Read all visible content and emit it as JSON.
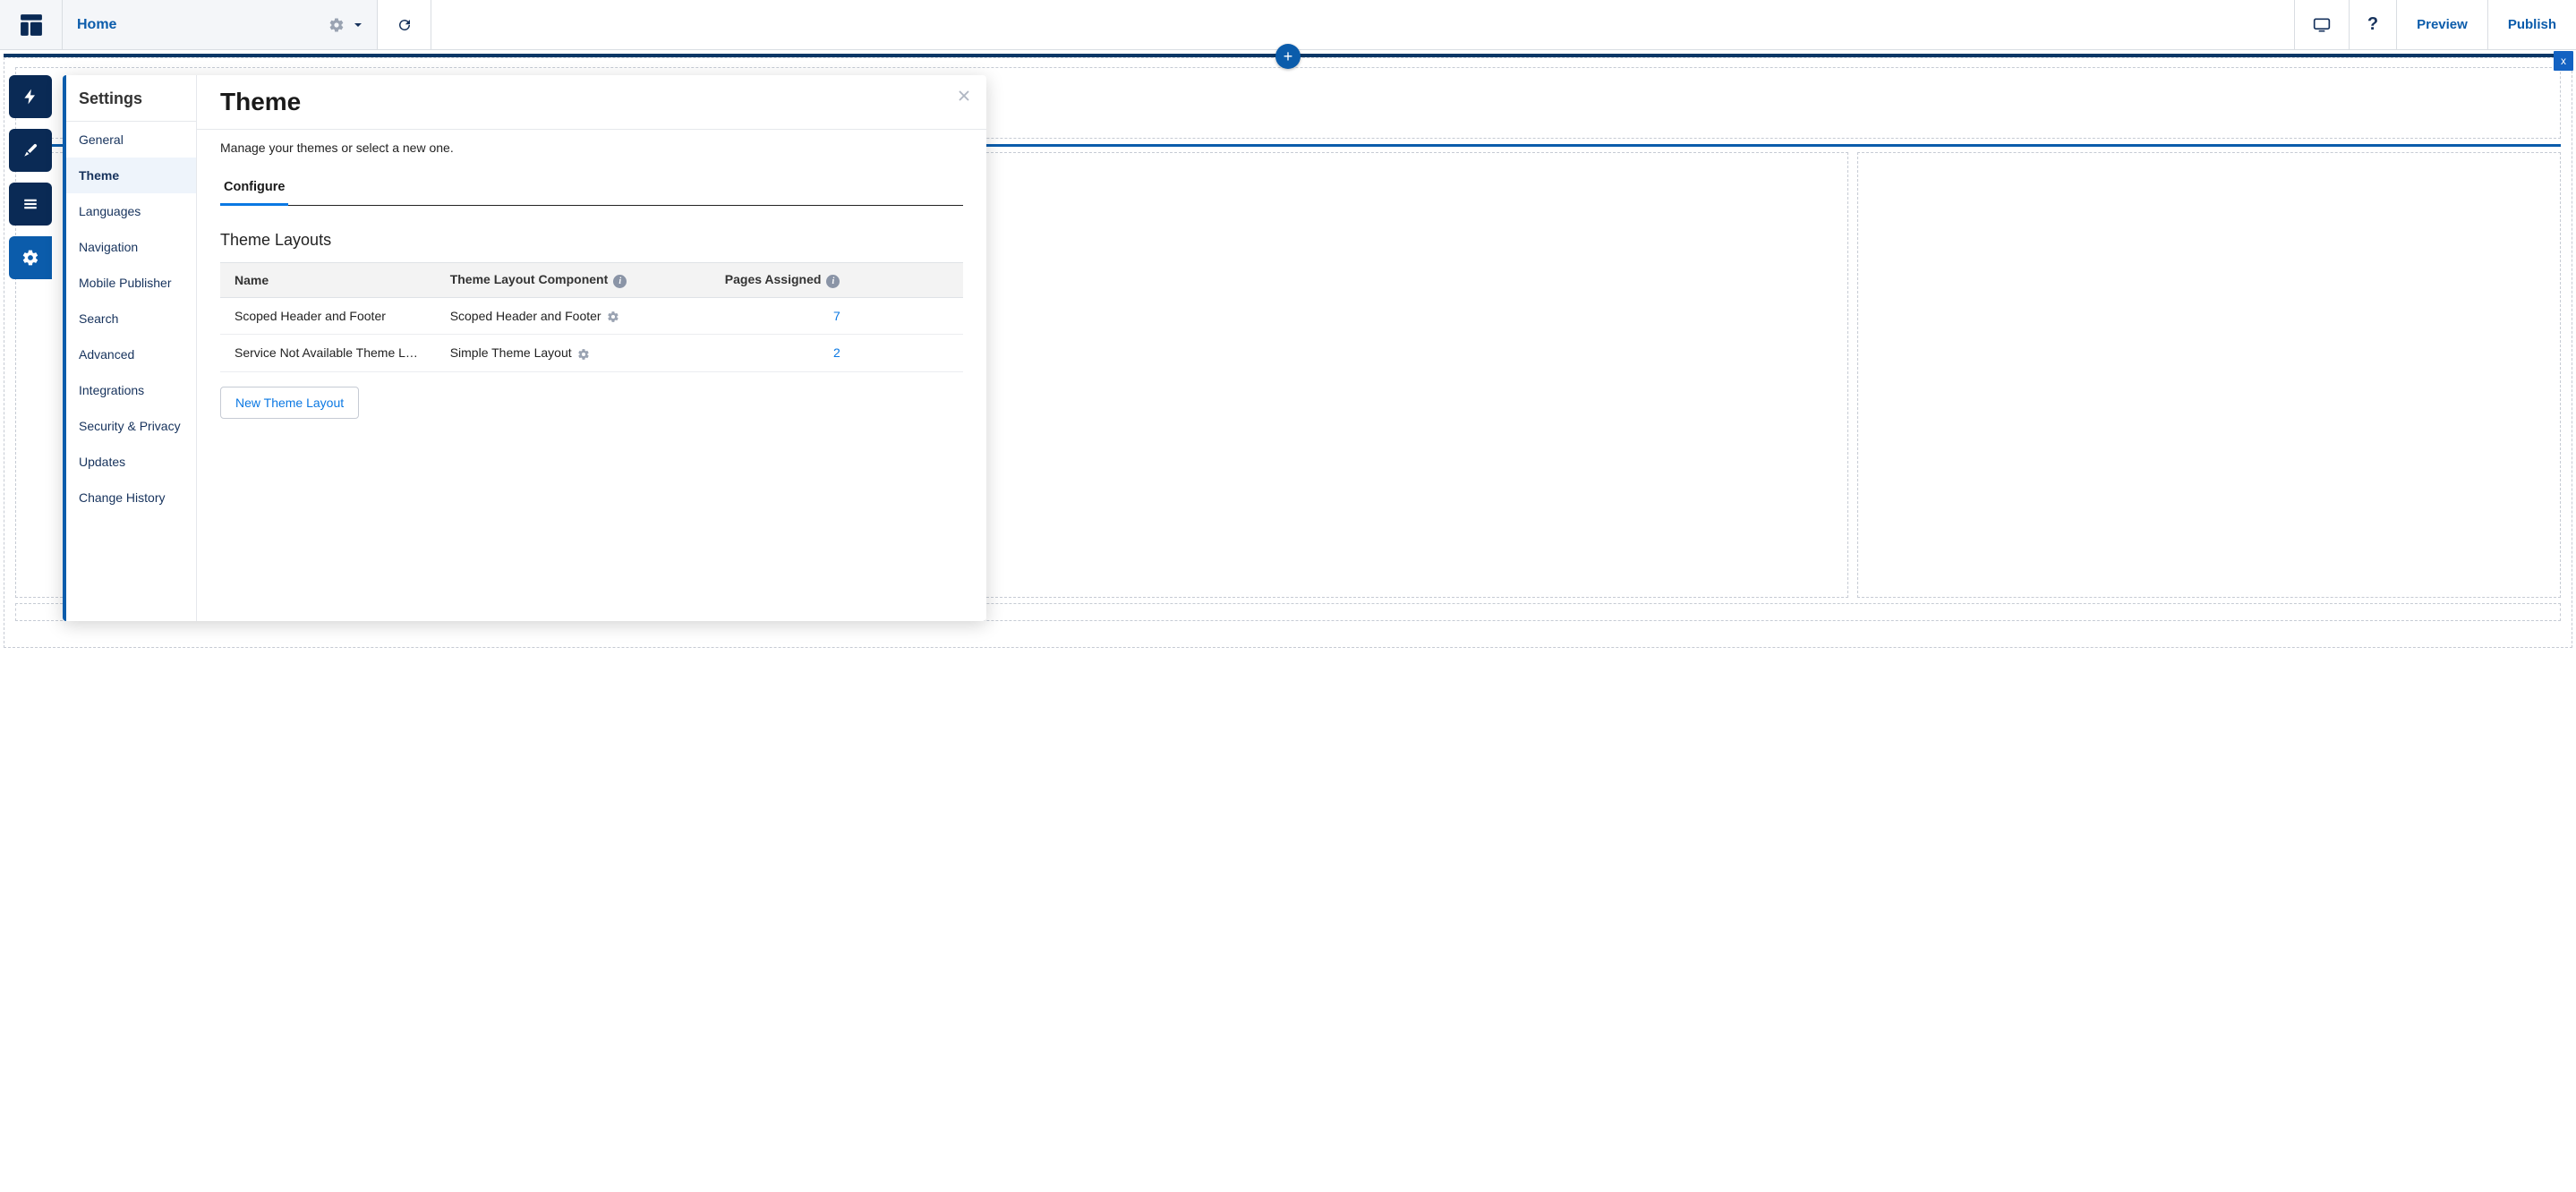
{
  "topbar": {
    "page_name": "Home",
    "preview_label": "Preview",
    "publish_label": "Publish"
  },
  "modal": {
    "side_title": "Settings",
    "side_items": [
      "General",
      "Theme",
      "Languages",
      "Navigation",
      "Mobile Publisher",
      "Search",
      "Advanced",
      "Integrations",
      "Security & Privacy",
      "Updates",
      "Change History"
    ],
    "active_index": 1,
    "title": "Theme",
    "subtitle": "Manage your themes or select a new one.",
    "tab_label": "Configure",
    "section_title": "Theme Layouts",
    "columns": {
      "name": "Name",
      "component": "Theme Layout Component",
      "pages": "Pages Assigned"
    },
    "rows": [
      {
        "name": "Scoped Header and Footer",
        "component": "Scoped Header and Footer",
        "pages": "7"
      },
      {
        "name": "Service Not Available Theme L…",
        "component": "Simple Theme Layout",
        "pages": "2"
      }
    ],
    "new_button": "New Theme Layout"
  },
  "misc": {
    "close_x": "x",
    "plus": "+"
  }
}
